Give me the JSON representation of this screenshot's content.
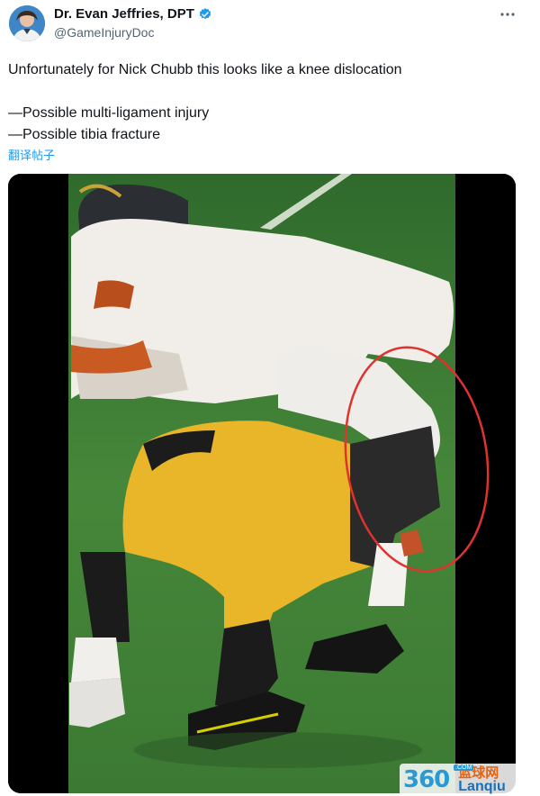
{
  "author": {
    "name": "Dr. Evan Jeffries, DPT",
    "handle": "@GameInjuryDoc",
    "avatar_icon": "person-avatar",
    "verified_icon": "verified-badge-icon",
    "verified_color": "#1d9bf0"
  },
  "tweet": {
    "line1": "Unfortunately for Nick Chubb this looks like a knee dislocation",
    "line2": "—Possible multi-ligament injury",
    "line3": "—Possible tibia fracture",
    "translate_label": "翻译帖子"
  },
  "menu": {
    "more_icon": "more-horizontal-icon"
  },
  "media": {
    "annotation_color": "#e0322e",
    "annotation_shape": "ellipse"
  },
  "watermark": {
    "number": "360",
    "com": ".COM",
    "cn": "蓝球网",
    "en": "Lanqiu"
  },
  "colors": {
    "accent": "#1d9bf0",
    "text": "#0f1419",
    "secondary": "#536471"
  }
}
